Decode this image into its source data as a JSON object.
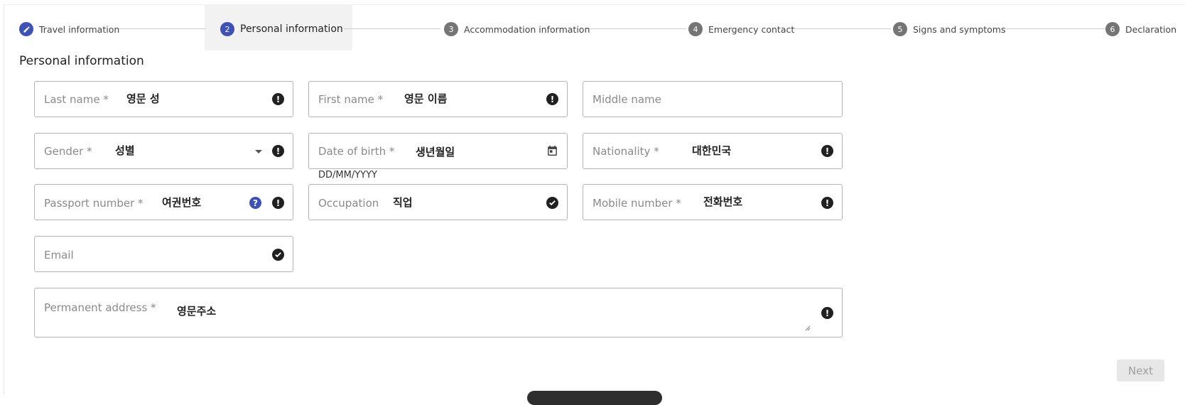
{
  "stepper": {
    "steps": [
      {
        "number": "",
        "label": "Travel information",
        "state": "completed"
      },
      {
        "number": "2",
        "label": "Personal information",
        "state": "active"
      },
      {
        "number": "3",
        "label": "Accommodation information",
        "state": "pending"
      },
      {
        "number": "4",
        "label": "Emergency contact",
        "state": "pending"
      },
      {
        "number": "5",
        "label": "Signs and symptoms",
        "state": "pending"
      },
      {
        "number": "6",
        "label": "Declaration",
        "state": "pending"
      }
    ]
  },
  "section_title": "Personal information",
  "fields": {
    "last_name": {
      "label": "Last name *",
      "value": "영문 성",
      "icon": "alert-icon"
    },
    "first_name": {
      "label": "First name *",
      "value": "영문 이름",
      "icon": "alert-icon"
    },
    "middle_name": {
      "label": "Middle name",
      "value": ""
    },
    "gender": {
      "label": "Gender *",
      "value": "성별",
      "icon": "alert-icon"
    },
    "date_of_birth": {
      "label": "Date of birth *",
      "value": "생년월일",
      "helper": "DD/MM/YYYY",
      "icon": "calendar-icon"
    },
    "nationality": {
      "label": "Nationality *",
      "value": "대한민국",
      "icon": "alert-icon"
    },
    "passport_number": {
      "label": "Passport number *",
      "value": "여권번호",
      "help_icon": "help-icon",
      "icon": "alert-icon"
    },
    "occupation": {
      "label": "Occupation",
      "value": "직업",
      "icon": "check-icon"
    },
    "mobile_number": {
      "label": "Mobile number *",
      "value": "전화번호",
      "icon": "alert-icon"
    },
    "email": {
      "label": "Email",
      "value": "",
      "icon": "check-icon"
    },
    "permanent_address": {
      "label": "Permanent address *",
      "value": "영문주소",
      "icon": "alert-icon"
    }
  },
  "actions": {
    "next_label": "Next"
  },
  "colors": {
    "accent": "#3f51b5",
    "step_inactive": "#757575",
    "icon_dark": "#212121",
    "disabled_button": "#e7e7e7"
  }
}
